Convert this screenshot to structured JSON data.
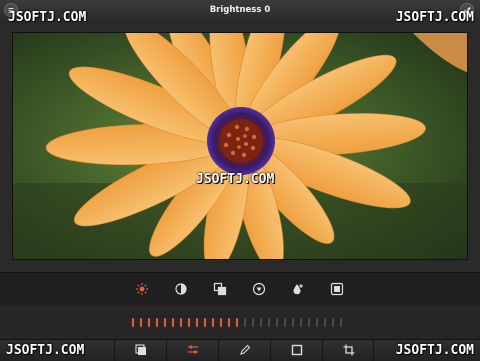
{
  "header": {
    "title": "Brightness 0"
  },
  "watermark": "JSOFTJ.COM",
  "filters": {
    "items": [
      "brightness",
      "contrast",
      "saturation",
      "warmth",
      "exposure",
      "vignette"
    ],
    "active": "brightness",
    "accent": "#e06040"
  },
  "slider": {
    "active_ticks": 14,
    "total_ticks": 27
  },
  "toolbar": {
    "items": [
      "effects",
      "adjust",
      "draw",
      "frame",
      "crop"
    ],
    "active": "adjust"
  }
}
